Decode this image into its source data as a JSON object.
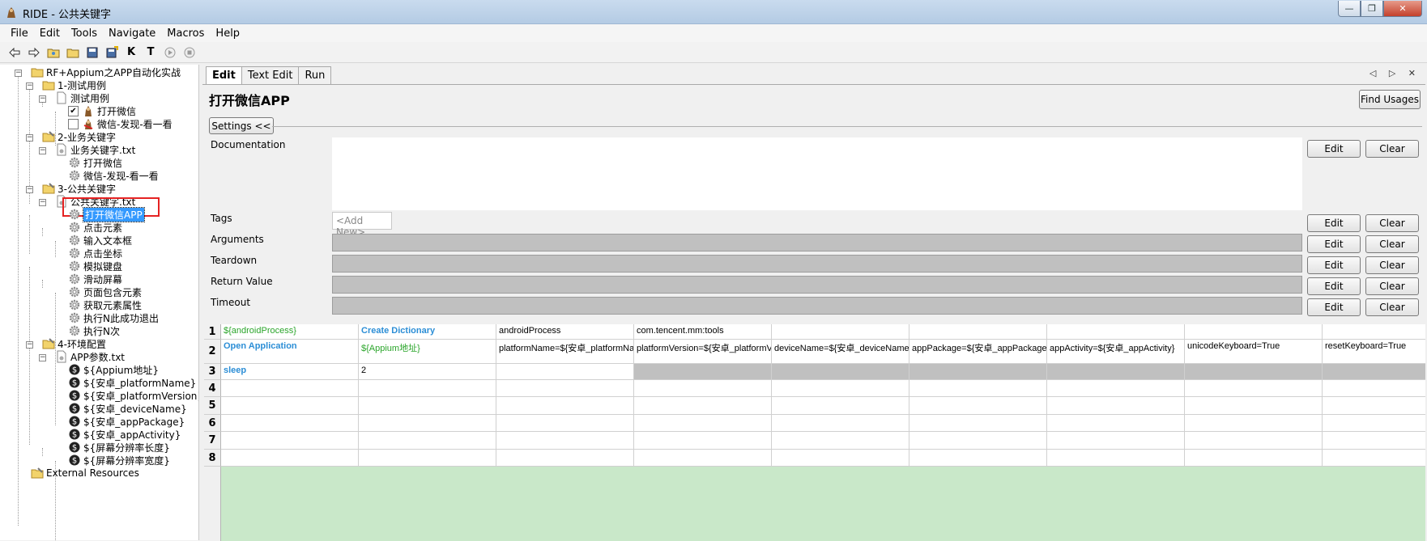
{
  "window": {
    "title": "RIDE - 公共关键字",
    "controls": [
      "—",
      "❐",
      "✕"
    ]
  },
  "menu": [
    "File",
    "Edit",
    "Tools",
    "Navigate",
    "Macros",
    "Help"
  ],
  "toolbar": {
    "k_label": "K",
    "t_label": "T"
  },
  "tree": {
    "root": "RF+Appium之APP自动化实战",
    "n1": "1-测试用例",
    "n1_file": "测试用例",
    "n1_case1": "打开微信",
    "n1_case2": "微信-发现-看一看",
    "n2": "2-业务关键字",
    "n2_file": "业务关键字.txt",
    "n2_kw1": "打开微信",
    "n2_kw2": "微信-发现-看一看",
    "n3": "3-公共关键字",
    "n3_file": "公共关键字.txt",
    "n3_kws": [
      "打开微信APP",
      "点击元素",
      "输入文本框",
      "点击坐标",
      "模拟键盘",
      "滑动屏幕",
      "页面包含元素",
      "获取元素属性",
      "执行N此成功退出",
      "执行N次"
    ],
    "n4": "4-环境配置",
    "n4_file": "APP参数.txt",
    "n4_vars": [
      "${Appium地址}",
      "${安卓_platformName}",
      "${安卓_platformVersion}",
      "${安卓_deviceName}",
      "${安卓_appPackage}",
      "${安卓_appActivity}",
      "${屏幕分辨率长度}",
      "${屏幕分辨率宽度}"
    ],
    "external": "External Resources"
  },
  "tabs": [
    "Edit",
    "Text Edit",
    "Run"
  ],
  "tab_nav": "◁ ▷ ✕",
  "editor": {
    "title": "打开微信APP",
    "find_usages": "Find Usages",
    "settings_toggle": "Settings <<",
    "labels": {
      "documentation": "Documentation",
      "tags": "Tags",
      "arguments": "Arguments",
      "teardown": "Teardown",
      "return_value": "Return Value",
      "timeout": "Timeout"
    },
    "tags_placeholder": "<Add New>",
    "edit_label": "Edit",
    "clear_label": "Clear"
  },
  "grid": {
    "rows": [
      {
        "num": "1",
        "cells": [
          "${androidProcess}",
          "Create Dictionary",
          "androidProcess",
          "com.tencent.mm:tools",
          "",
          "",
          "",
          "",
          ""
        ]
      },
      {
        "num": "2",
        "cells": [
          "Open Application",
          "${Appium地址}",
          "platformName=${安卓_platformName}",
          "platformVersion=${安卓_platformVersion}",
          "deviceName=${安卓_deviceName}",
          "appPackage=${安卓_appPackage}",
          "appActivity=${安卓_appActivity}",
          "unicodeKeyboard=True",
          "resetKeyboard=True"
        ]
      },
      {
        "num": "3",
        "cells": [
          "sleep",
          "2",
          "",
          "",
          "",
          "",
          "",
          "",
          ""
        ]
      },
      {
        "num": "4",
        "cells": [
          "",
          "",
          "",
          "",
          "",
          "",
          "",
          "",
          ""
        ]
      },
      {
        "num": "5",
        "cells": [
          "",
          "",
          "",
          "",
          "",
          "",
          "",
          "",
          ""
        ]
      },
      {
        "num": "6",
        "cells": [
          "",
          "",
          "",
          "",
          "",
          "",
          "",
          "",
          ""
        ]
      },
      {
        "num": "7",
        "cells": [
          "",
          "",
          "",
          "",
          "",
          "",
          "",
          "",
          ""
        ]
      },
      {
        "num": "8",
        "cells": [
          "",
          "",
          "",
          "",
          "",
          "",
          "",
          "",
          ""
        ]
      }
    ]
  },
  "colors": {
    "variable": "#2aa52a",
    "keyword": "#2c8ed6",
    "selection": "#3399ff",
    "highlight_box": "#e52222",
    "grid_empty": "#c9e8c9"
  }
}
